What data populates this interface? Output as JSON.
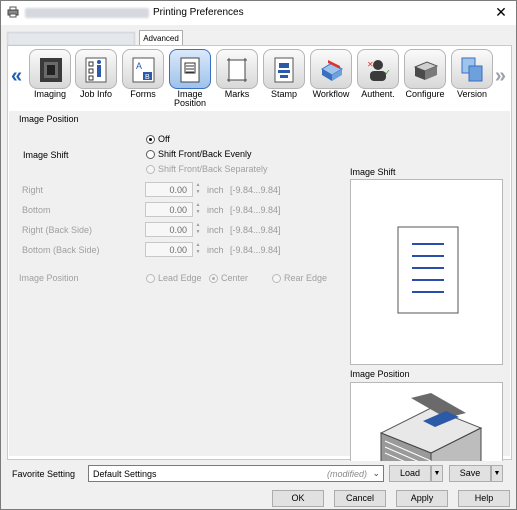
{
  "window": {
    "title": "Printing Preferences",
    "close_glyph": "✕",
    "tab_label": "Advanced"
  },
  "toolbar": {
    "nav_prev": "«",
    "nav_next": "»",
    "items": [
      {
        "label": "Imaging",
        "icon": "imaging-icon",
        "active": false
      },
      {
        "label": "Job Info",
        "icon": "job-info-icon",
        "active": false
      },
      {
        "label": "Forms",
        "icon": "forms-icon",
        "active": false
      },
      {
        "label": "Image Position",
        "icon": "image-position-icon",
        "active": true
      },
      {
        "label": "Marks",
        "icon": "marks-icon",
        "active": false
      },
      {
        "label": "Stamp",
        "icon": "stamp-icon",
        "active": false
      },
      {
        "label": "Workflow",
        "icon": "workflow-icon",
        "active": false
      },
      {
        "label": "Authent.",
        "icon": "authentication-icon",
        "active": false
      },
      {
        "label": "Configure",
        "icon": "configure-icon",
        "active": false
      },
      {
        "label": "Version",
        "icon": "version-icon",
        "active": false
      }
    ]
  },
  "image_position_group": {
    "title": "Image Position",
    "image_shift_label": "Image Shift",
    "shift_options": [
      {
        "label": "Off",
        "selected": true,
        "enabled": true
      },
      {
        "label": "Shift Front/Back Evenly",
        "selected": false,
        "enabled": true
      },
      {
        "label": "Shift Front/Back Separately",
        "selected": false,
        "enabled": false
      }
    ],
    "fields": [
      {
        "label": "Right",
        "value": "0.00",
        "unit": "inch",
        "range": "[-9.84...9.84]"
      },
      {
        "label": "Bottom",
        "value": "0.00",
        "unit": "inch",
        "range": "[-9.84...9.84]"
      },
      {
        "label": "Right (Back Side)",
        "value": "0.00",
        "unit": "inch",
        "range": "[-9.84...9.84]"
      },
      {
        "label": "Bottom (Back Side)",
        "value": "0.00",
        "unit": "inch",
        "range": "[-9.84...9.84]"
      }
    ],
    "position_label": "Image Position",
    "position_options": [
      {
        "label": "Lead Edge",
        "selected": false
      },
      {
        "label": "Center",
        "selected": true
      },
      {
        "label": "Rear Edge",
        "selected": false
      }
    ]
  },
  "previews": {
    "image_shift_title": "Image Shift",
    "image_position_title": "Image Position"
  },
  "footer": {
    "favorite_label": "Favorite Setting",
    "favorite_value": "Default Settings",
    "favorite_state": "(modified)",
    "load_label": "Load",
    "save_label": "Save",
    "ok_label": "OK",
    "cancel_label": "Cancel",
    "apply_label": "Apply",
    "help_label": "Help"
  }
}
